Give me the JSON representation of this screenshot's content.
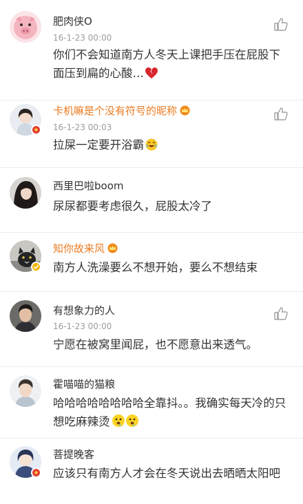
{
  "comments": [
    {
      "username": "肥肉侠O",
      "timestamp": "16-1-23 00:00",
      "text": "你们不会知道南方人冬天上课把手压在屁股下面压到扁的心酸…",
      "emoji": "broken-heart-emoji",
      "avatar": "pig-avatar",
      "has_like": true
    },
    {
      "username": "卡机嘛是个没有符号的昵称",
      "timestamp": "16-1-23 00:03",
      "text": "拉屎一定要开浴霸",
      "emoji": "laughing-tears-emoji",
      "avatar": "girl-avatar",
      "has_like": true,
      "vip": true
    },
    {
      "username": "西里巴啦boom",
      "text": "尿尿都要考虑很久，屁股太冷了",
      "avatar": "dark-hair-girl-avatar"
    },
    {
      "username": "知你故来风",
      "text": "南方人洗澡要么不想开始，要么不想结束",
      "avatar": "cat-avatar",
      "vip": true
    },
    {
      "username": "有想象力的人",
      "timestamp": "16-1-23 00:00",
      "text": "宁愿在被窝里闻屁，也不愿意出来透气。",
      "avatar": "man-avatar",
      "has_like": true
    },
    {
      "username": "霍喵喵的猫粮",
      "text": "哈哈哈哈哈哈哈哈全靠抖。。我确实每天冷的只想吃麻辣烫",
      "emoji": "drooling-emoji",
      "avatar": "young-man-avatar"
    },
    {
      "username": "菩提晚客",
      "text": "应该只有南方人才会在冬天说出去晒晒太阳吧",
      "avatar": "anime-avatar"
    }
  ],
  "colors": {
    "vip_name": "#eb7b22",
    "timestamp": "#9b9b9b",
    "text": "#333333",
    "badge_red": "#e03c31",
    "badge_gold": "#f7b500"
  }
}
